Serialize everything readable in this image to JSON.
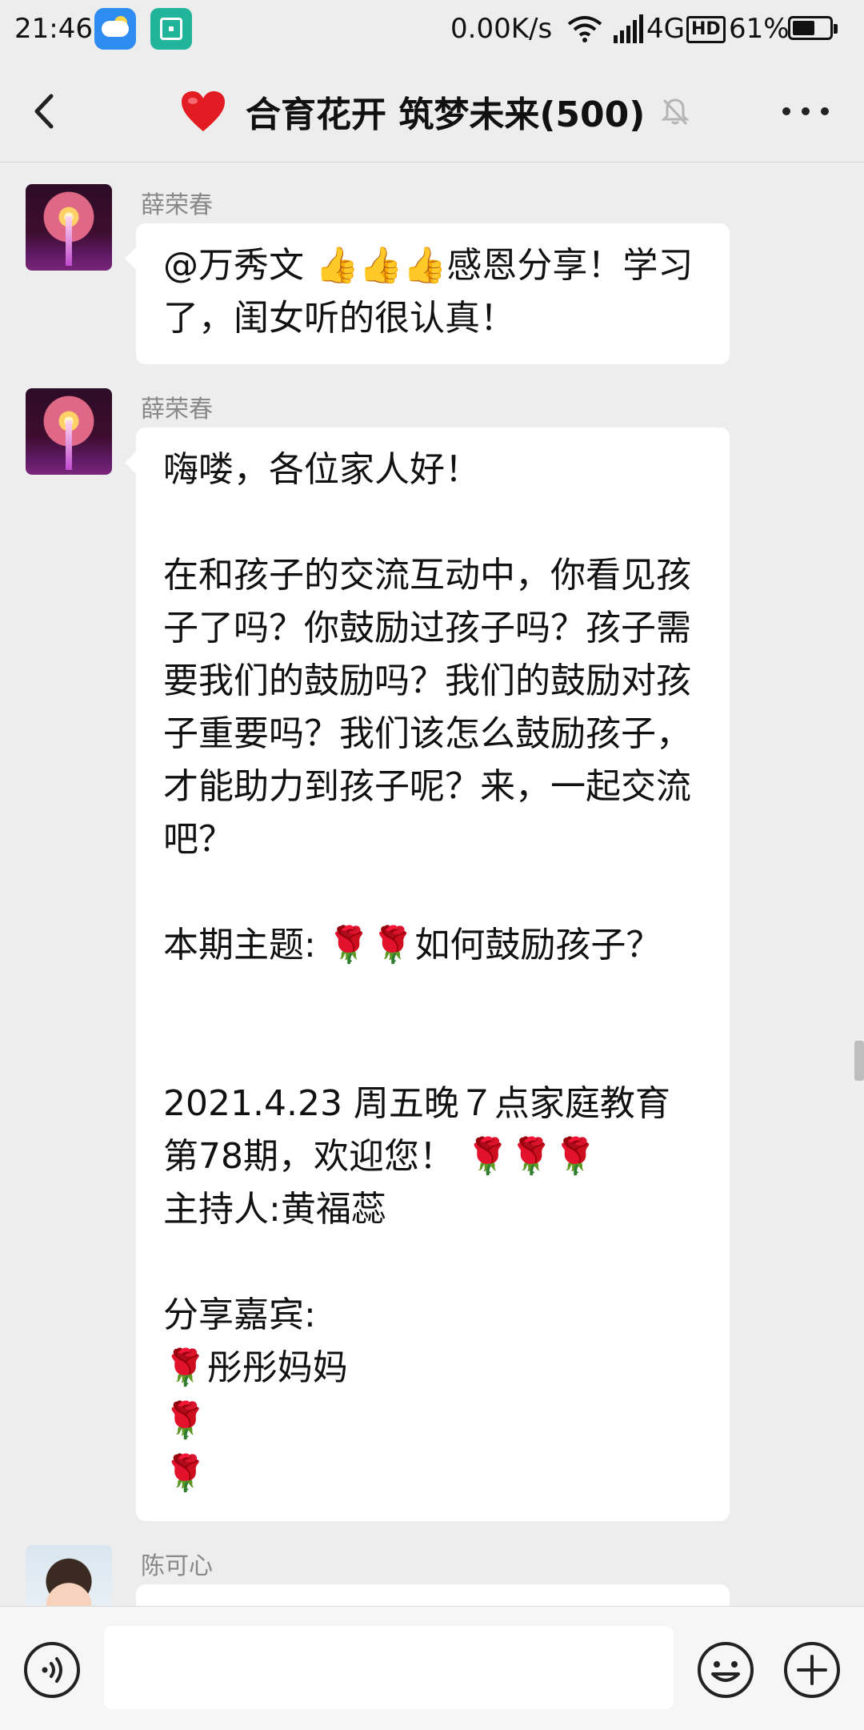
{
  "status_bar": {
    "time": "21:46",
    "net_speed": "0.00K/s",
    "network": "4G",
    "hd_badge": "HD",
    "battery_text": "61%",
    "battery_level": 0.61,
    "app_icons": [
      "weather-icon",
      "scanner-icon"
    ]
  },
  "header": {
    "title": "合育花开 筑梦未来(500)",
    "title_emoji": "heart-icon",
    "muted": true
  },
  "messages": [
    {
      "sender": "薛荣春",
      "avatar": "fireworks-avatar",
      "text": "@万秀文 👍👍👍感恩分享！学习了，闺女听的很认真！"
    },
    {
      "sender": "薛荣春",
      "avatar": "fireworks-avatar",
      "text": "嗨喽，各位家人好！\n\n在和孩子的交流互动中，你看见孩子了吗？你鼓励过孩子吗？孩子需要我们的鼓励吗？我们的鼓励对孩子重要吗？我们该怎么鼓励孩子，才能助力到孩子呢？来，一起交流吧？\n\n本期主题: 🌹🌹如何鼓励孩子？\n\n\n2021.4.23 周五晚７点家庭教育第78期，欢迎您！ 🌹🌹🌹\n主持人:黄福蕊\n\n分享嘉宾:\n🌹彤彤妈妈\n🌹\n🌹"
    },
    {
      "sender": "陈可心",
      "avatar": "child-avatar",
      "text": ""
    }
  ],
  "colors": {
    "background": "#ededed",
    "bubble": "#ffffff",
    "sender_name": "#888888",
    "accent_red": "#d9232e"
  }
}
